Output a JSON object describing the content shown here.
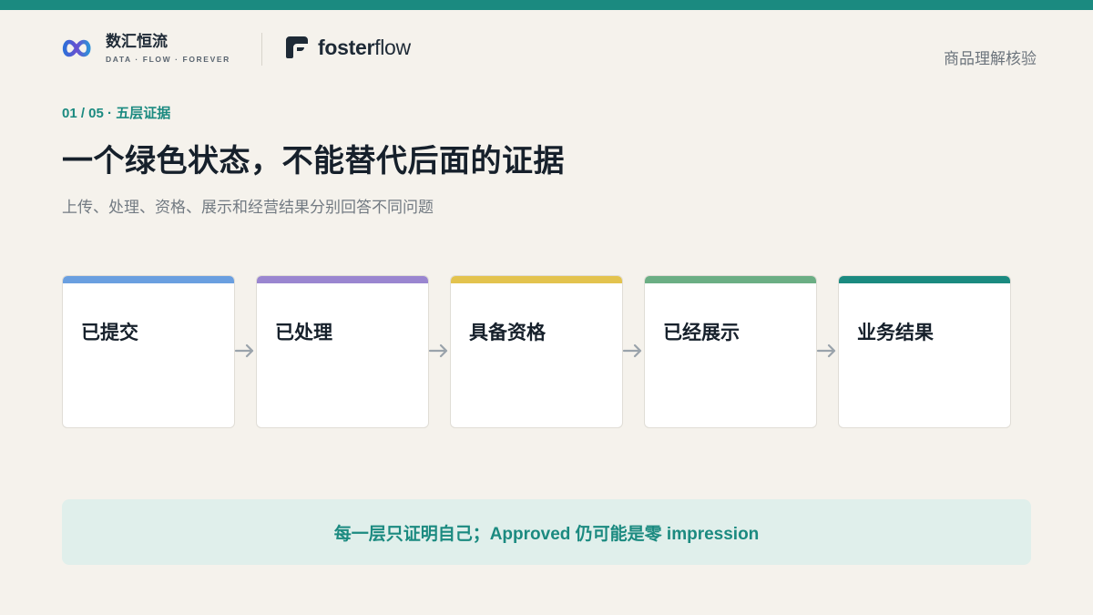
{
  "brand": {
    "name": "数汇恒流",
    "tagline": "DATA · FLOW · FOREVER",
    "logo_icon": "infinity-loop-icon"
  },
  "partner": {
    "name_bold": "foster",
    "name_light": "flow",
    "logo_icon": "fosterflow-f-icon"
  },
  "header": {
    "right_label": "商品理解核验"
  },
  "kicker": "01 / 05 · 五层证据",
  "title": "一个绿色状态，不能替代后面的证据",
  "subtitle": "上传、处理、资格、展示和经营结果分别回答不同问题",
  "steps": [
    {
      "label": "已提交",
      "color": "#6a9fe0"
    },
    {
      "label": "已处理",
      "color": "#9a86d0"
    },
    {
      "label": "具备资格",
      "color": "#e3c34e"
    },
    {
      "label": "已经展示",
      "color": "#6bae84"
    },
    {
      "label": "业务结果",
      "color": "#1b8a80"
    }
  ],
  "note": "每一层只证明自己；Approved 仍可能是零 impression",
  "colors": {
    "accent": "#1b8a80",
    "background": "#f5f2ec",
    "note_background": "#e0efeb",
    "arrow": "#9aa3ab"
  }
}
